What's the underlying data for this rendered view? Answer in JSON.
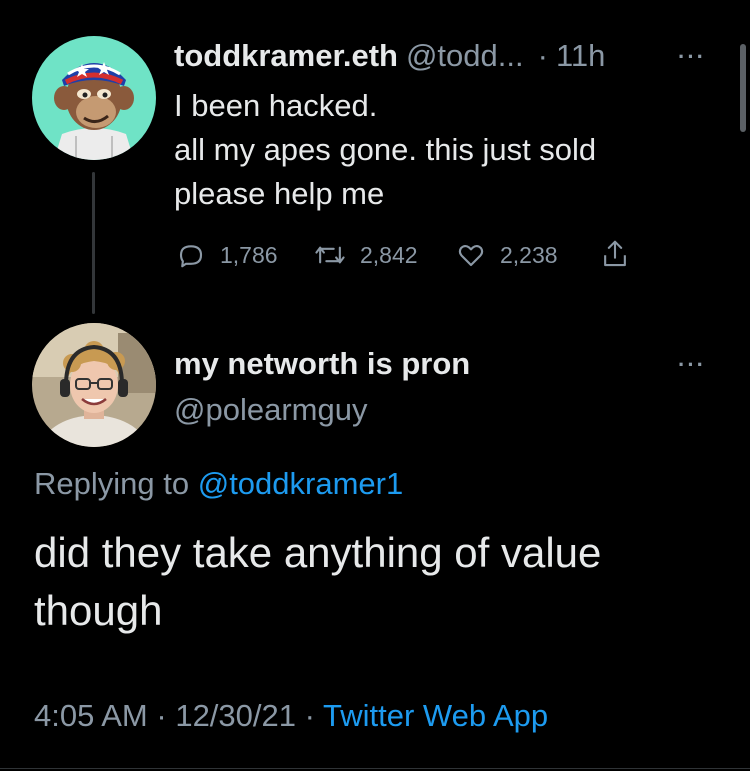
{
  "original_tweet": {
    "display_name": "toddkramer.eth",
    "handle": "@todd...",
    "separator": "·",
    "time": "11h",
    "more": "···",
    "text": "I been hacked.\nall my apes gone. this just sold\nplease help me",
    "stats": {
      "replies": "1,786",
      "retweets": "2,842",
      "likes": "2,238"
    }
  },
  "reply": {
    "display_name": "my networth is pron",
    "handle": "@polearmguy",
    "more": "···",
    "replying_prefix": "Replying to",
    "replying_to": "@toddkramer1",
    "text": "did they take anything of value\nthough",
    "meta": {
      "time": "4:05 AM",
      "separator": "·",
      "date": "12/30/21",
      "separator2": "·",
      "source": "Twitter Web App"
    }
  },
  "colors": {
    "background": "#000000",
    "text_primary": "#e7e9ea",
    "text_secondary": "#8b98a5",
    "link": "#1d9bf0"
  }
}
